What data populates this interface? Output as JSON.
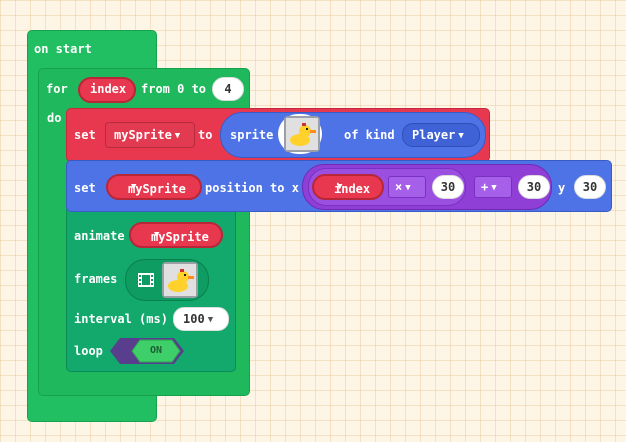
{
  "blocks": {
    "on_start": "on start",
    "for_loop": {
      "for": "for",
      "variable": "index",
      "from_to": "from 0 to",
      "end": "4",
      "do": "do"
    },
    "set_sprite": {
      "set": "set",
      "variable": "mySprite",
      "to": "to",
      "sprite": "sprite",
      "of_kind": "of kind",
      "kind": "Player"
    },
    "set_position": {
      "set": "set",
      "variable": "mySprite",
      "position_to_x": "position to x",
      "index_var": "index",
      "op1": "×",
      "op1_value": "30",
      "op2": "+",
      "op2_value": "30",
      "y": "y",
      "y_value": "30"
    },
    "animate": {
      "animate": "animate",
      "variable": "mySprite",
      "frames": "frames",
      "interval": "interval (ms)",
      "interval_value": "100",
      "loop": "loop",
      "toggle": "ON"
    }
  },
  "colors": {
    "green": "#22bf62",
    "dark_green": "#13a86c",
    "red": "#e8384f",
    "blue": "#4e73e6",
    "purple": "#8f3fd6",
    "toggle_dark": "#5a3e8e",
    "toggle_on": "#3ecf6a"
  }
}
